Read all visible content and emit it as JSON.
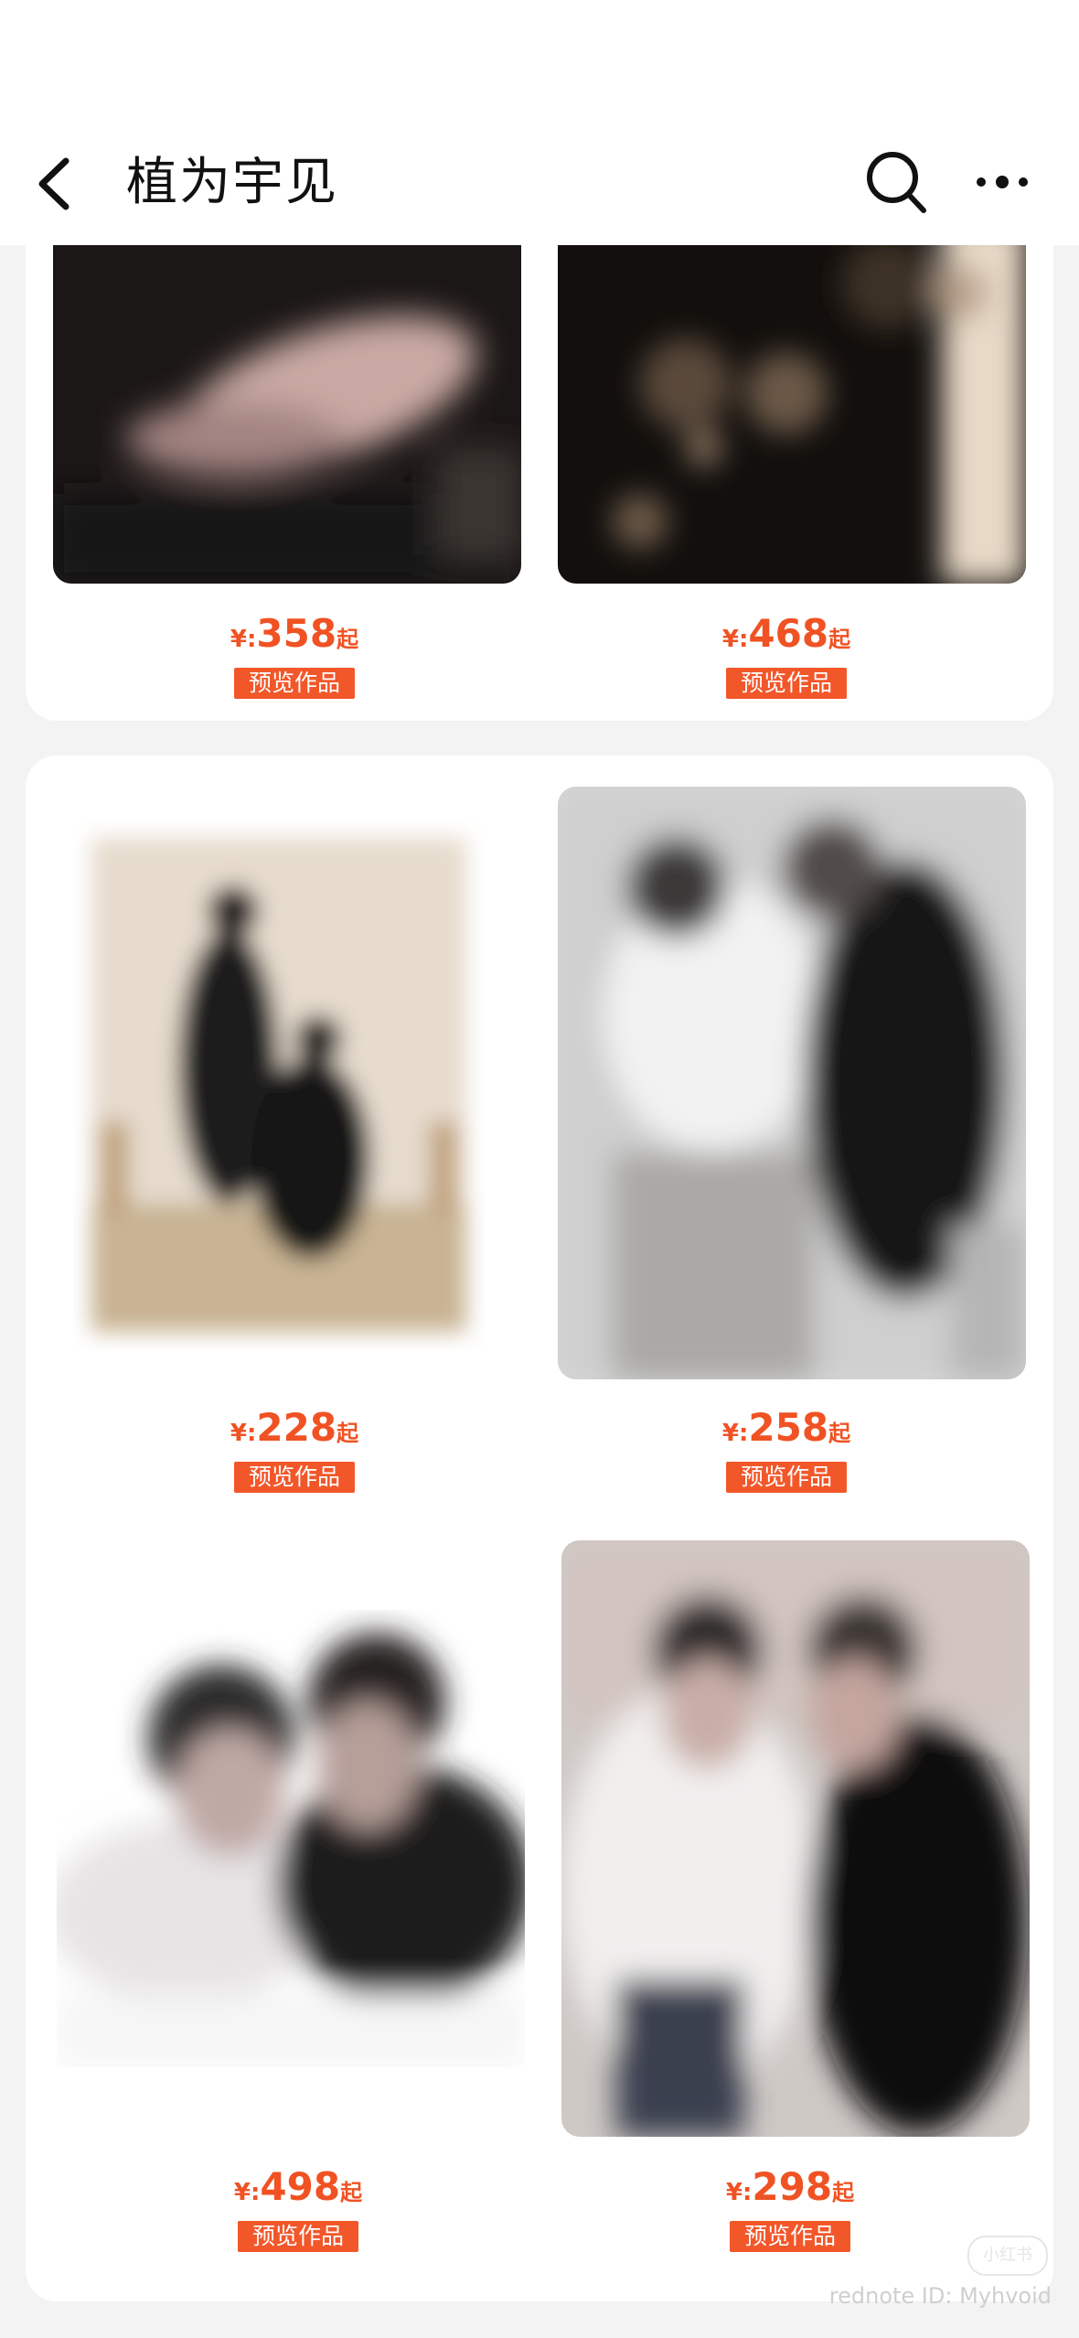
{
  "header": {
    "title": "植为宇见",
    "back_icon": "chevron-left-icon",
    "search_icon": "search-icon",
    "more_icon": "more-horizontal-icon"
  },
  "products": [
    {
      "currency": "¥:",
      "price": "358",
      "suffix": "起",
      "tag": "预览作品"
    },
    {
      "currency": "¥:",
      "price": "468",
      "suffix": "起",
      "tag": "预览作品"
    },
    {
      "currency": "¥:",
      "price": "228",
      "suffix": "起",
      "tag": "预览作品"
    },
    {
      "currency": "¥:",
      "price": "258",
      "suffix": "起",
      "tag": "预览作品"
    },
    {
      "currency": "¥:",
      "price": "498",
      "suffix": "起",
      "tag": "预览作品"
    },
    {
      "currency": "¥:",
      "price": "298",
      "suffix": "起",
      "tag": "预览作品"
    }
  ],
  "watermark": {
    "logo": "小红书",
    "text": "rednote ID: Myhvoid"
  },
  "colors": {
    "accent": "#f05223",
    "tag_bg": "#f2572a",
    "page_bg": "#f3f3f3"
  }
}
